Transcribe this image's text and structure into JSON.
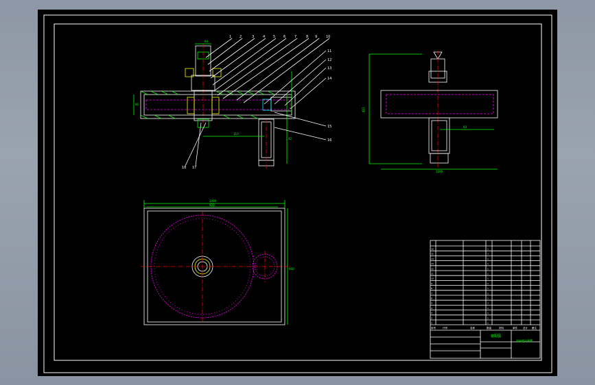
{
  "drawing": {
    "balloons_top": [
      "1",
      "2",
      "3",
      "4",
      "5",
      "6",
      "7",
      "8",
      "9",
      "10"
    ],
    "balloons_right": [
      "11",
      "12",
      "13",
      "14"
    ],
    "balloons_lower": [
      "15",
      "16"
    ],
    "balloons_bottom": [
      "18",
      "17"
    ],
    "dims_side": [
      "310",
      "64",
      "80",
      "42"
    ],
    "dims_right_view": [
      "402",
      "1200",
      "60",
      "1300"
    ],
    "dims_plan": [
      "1000",
      "920",
      "600"
    ]
  },
  "title_block": {
    "parts_rows": [
      [
        "16",
        "",
        "",
        "1",
        "",
        "",
        ""
      ],
      [
        "15",
        "",
        "",
        "1",
        "",
        "",
        ""
      ],
      [
        "14",
        "",
        "",
        "1",
        "",
        "",
        ""
      ],
      [
        "13",
        "",
        "",
        "1",
        "",
        "",
        ""
      ],
      [
        "12",
        "",
        "",
        "1",
        "",
        "",
        ""
      ],
      [
        "11",
        "",
        "",
        "1",
        "",
        "",
        ""
      ],
      [
        "10",
        "",
        "",
        "1",
        "",
        "",
        ""
      ],
      [
        "9",
        "",
        "",
        "1",
        "",
        "",
        ""
      ],
      [
        "8",
        "",
        "",
        "1",
        "",
        "",
        ""
      ],
      [
        "7",
        "",
        "",
        "1",
        "",
        "",
        ""
      ],
      [
        "6",
        "",
        "",
        "1",
        "",
        "",
        ""
      ],
      [
        "5",
        "",
        "",
        "1",
        "",
        "",
        ""
      ],
      [
        "4",
        "",
        "",
        "1",
        "",
        "",
        ""
      ],
      [
        "3",
        "",
        "",
        "1",
        "",
        "",
        ""
      ],
      [
        "2",
        "",
        "",
        "1",
        "",
        "",
        ""
      ],
      [
        "1",
        "",
        "",
        "1",
        "",
        "",
        ""
      ]
    ],
    "header_cells": [
      "序号",
      "代号",
      "名称",
      "数量",
      "材料",
      "单件",
      "总计",
      "备注"
    ],
    "title_green": "装配图",
    "drawing_name": "齿轮传动装置"
  },
  "colors": {
    "background": "#000000",
    "frame": "#ffffff",
    "dimension": "#00ff00",
    "centerline": "#ff0000",
    "hidden": "#ff00ff",
    "thread": "#ffff00",
    "section": "#00ffff"
  }
}
